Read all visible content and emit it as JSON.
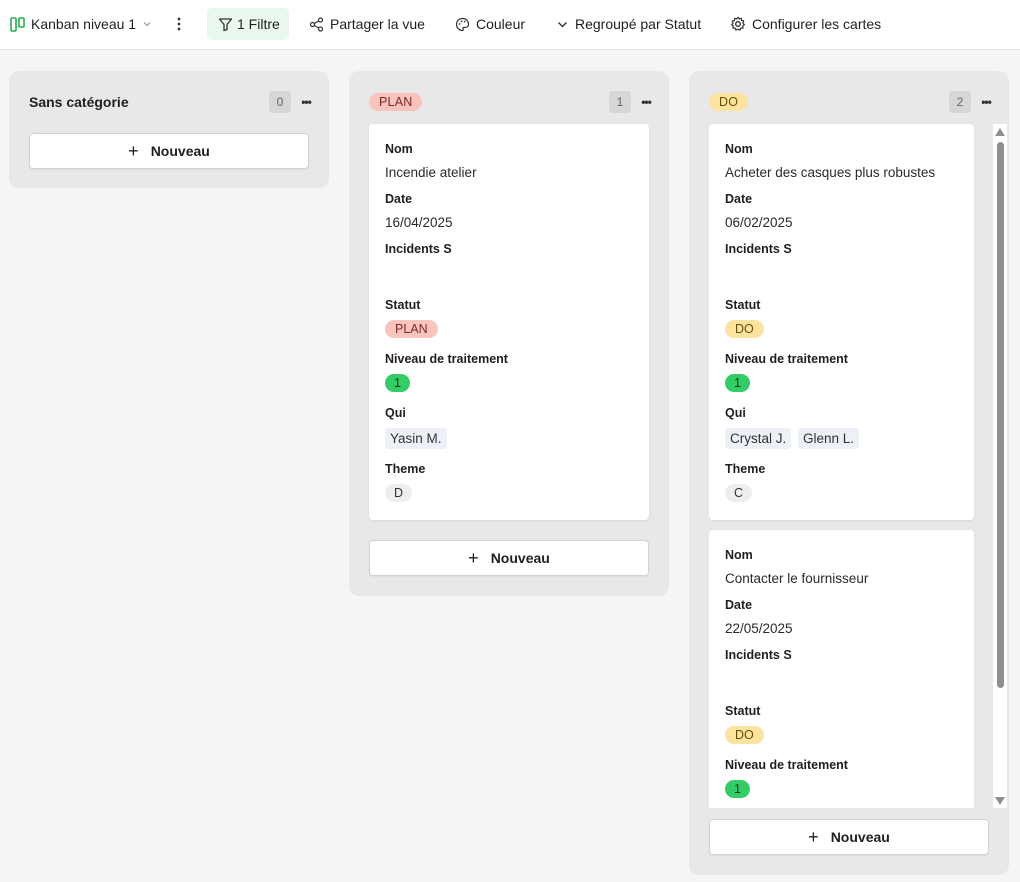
{
  "toolbar": {
    "view_name": "Kanban niveau 1",
    "filter_label": "1 Filtre",
    "share_label": "Partager la vue",
    "color_label": "Couleur",
    "group_label": "Regroupé par Statut",
    "config_label": "Configurer les cartes"
  },
  "colors": {
    "accent": "#22b14c",
    "plan_pill": "#f8c4bd",
    "do_pill": "#fde3a0",
    "level_green": "#33cc66"
  },
  "columns": [
    {
      "title": "Sans catégorie",
      "count": "0",
      "new_label": "Nouveau",
      "cards": []
    },
    {
      "title": "PLAN",
      "count": "1",
      "new_label": "Nouveau",
      "cards": [
        {
          "labels": {
            "nom": "Nom",
            "date": "Date",
            "incidents": "Incidents S",
            "statut": "Statut",
            "niveau": "Niveau de traitement",
            "qui": "Qui",
            "theme": "Theme"
          },
          "nom": "Incendie atelier",
          "date": "16/04/2025",
          "incidents": "",
          "statut": "PLAN",
          "niveau": "1",
          "qui": [
            "Yasin M."
          ],
          "theme": "D"
        }
      ]
    },
    {
      "title": "DO",
      "count": "2",
      "new_label": "Nouveau",
      "cards": [
        {
          "labels": {
            "nom": "Nom",
            "date": "Date",
            "incidents": "Incidents S",
            "statut": "Statut",
            "niveau": "Niveau de traitement",
            "qui": "Qui",
            "theme": "Theme"
          },
          "nom": "Acheter des casques plus robustes",
          "date": "06/02/2025",
          "incidents": "",
          "statut": "DO",
          "niveau": "1",
          "qui": [
            "Crystal J.",
            "Glenn L."
          ],
          "theme": "C"
        },
        {
          "labels": {
            "nom": "Nom",
            "date": "Date",
            "incidents": "Incidents S",
            "statut": "Statut",
            "niveau": "Niveau de traitement"
          },
          "nom": "Contacter le fournisseur",
          "date": "22/05/2025",
          "incidents": "",
          "statut": "DO",
          "niveau": "1"
        }
      ]
    }
  ]
}
